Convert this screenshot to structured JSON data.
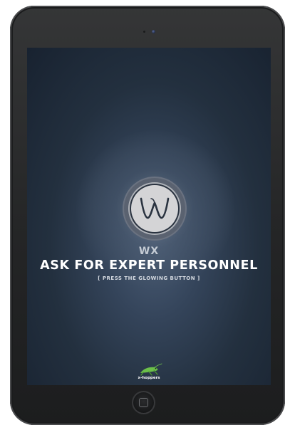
{
  "app": {
    "logo_letter": "W",
    "subtitle": "WX",
    "headline": "ASK FOR EXPERT PERSONNEL",
    "hint": "[ PRESS THE GLOWING BUTTON ]"
  },
  "brand": {
    "name": "x-hoppers"
  },
  "colors": {
    "screen_bg": "#23303f",
    "device_body": "#242526",
    "brand_green": "#6cc04a"
  },
  "icons": {
    "logo_button": "w-logo-icon",
    "brand_logo": "grasshopper-icon",
    "home_button": "home-icon"
  }
}
